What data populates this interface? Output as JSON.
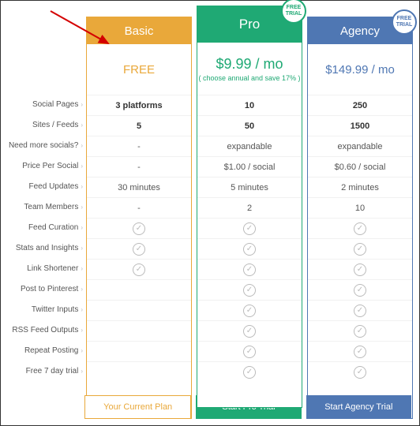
{
  "badge_text": "FREE TRIAL",
  "labels": [
    "Social Pages",
    "Sites / Feeds",
    "Need more socials?",
    "Price Per Social",
    "Feed Updates",
    "Team Members",
    "Feed Curation",
    "Stats and Insights",
    "Link Shortener",
    "Post to Pinterest",
    "Twitter Inputs",
    "RSS Feed Outputs",
    "Repeat Posting",
    "Free 7 day trial"
  ],
  "plans": {
    "basic": {
      "name": "Basic",
      "price": "FREE",
      "sub": "",
      "cells": [
        "3 platforms",
        "5",
        "-",
        "-",
        "30 minutes",
        "-",
        "check",
        "check",
        "check",
        "",
        "",
        "",
        "",
        ""
      ],
      "cta": "Your Current Plan"
    },
    "pro": {
      "name": "Pro",
      "price": "$9.99 / mo",
      "sub": "( choose annual and save 17% )",
      "cells": [
        "10",
        "50",
        "expandable",
        "$1.00 / social",
        "5 minutes",
        "2",
        "check",
        "check",
        "check",
        "check",
        "check",
        "check",
        "check",
        "check"
      ],
      "cta": "Start Pro Trial"
    },
    "agency": {
      "name": "Agency",
      "price": "$149.99 / mo",
      "sub": "",
      "cells": [
        "250",
        "1500",
        "expandable",
        "$0.60 / social",
        "2 minutes",
        "10",
        "check",
        "check",
        "check",
        "check",
        "check",
        "check",
        "check",
        "check"
      ],
      "cta": "Start Agency Trial"
    }
  }
}
